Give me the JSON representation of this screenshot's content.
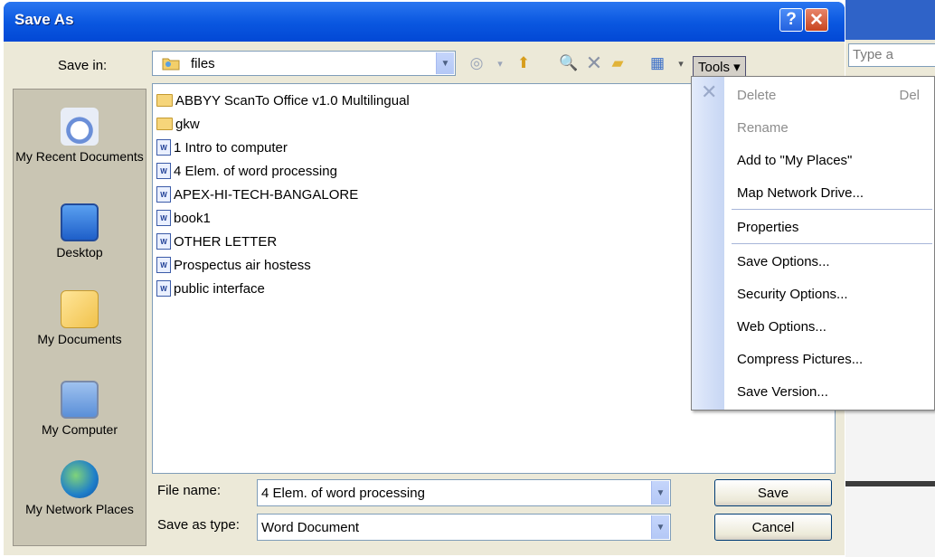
{
  "background": {
    "search_text": "Type a"
  },
  "dialog": {
    "title": "Save As",
    "help_label": "?",
    "close_label": "✕",
    "save_in_label": "Save in:",
    "save_in_value": "files",
    "tools_label": "Tools ▾"
  },
  "places": [
    {
      "label": "My Recent Documents"
    },
    {
      "label": "Desktop"
    },
    {
      "label": "My Documents"
    },
    {
      "label": "My Computer"
    },
    {
      "label": "My Network Places"
    }
  ],
  "files": [
    {
      "name": "ABBYY ScanTo Office v1.0 Multilingual",
      "type": "folder"
    },
    {
      "name": "gkw",
      "type": "folder"
    },
    {
      "name": "1 Intro to computer",
      "type": "doc"
    },
    {
      "name": "4 Elem. of word processing",
      "type": "doc"
    },
    {
      "name": "APEX-HI-TECH-BANGALORE",
      "type": "doc"
    },
    {
      "name": "book1",
      "type": "doc"
    },
    {
      "name": "OTHER LETTER",
      "type": "doc"
    },
    {
      "name": "Prospectus air hostess",
      "type": "doc"
    },
    {
      "name": "public interface",
      "type": "doc"
    }
  ],
  "bottom": {
    "file_name_label": "File name:",
    "file_name_value": "4 Elem. of word processing",
    "save_type_label": "Save as type:",
    "save_type_value": "Word Document",
    "save_button": "Save",
    "cancel_button": "Cancel"
  },
  "tools_menu": {
    "delete": "Delete",
    "delete_shortcut": "Del",
    "rename": "Rename",
    "add_my_places": "Add to \"My Places\"",
    "map_network": "Map Network Drive...",
    "properties": "Properties",
    "save_options": "Save Options...",
    "security_options": "Security Options...",
    "web_options": "Web Options...",
    "compress_pictures": "Compress Pictures...",
    "save_version": "Save Version..."
  }
}
